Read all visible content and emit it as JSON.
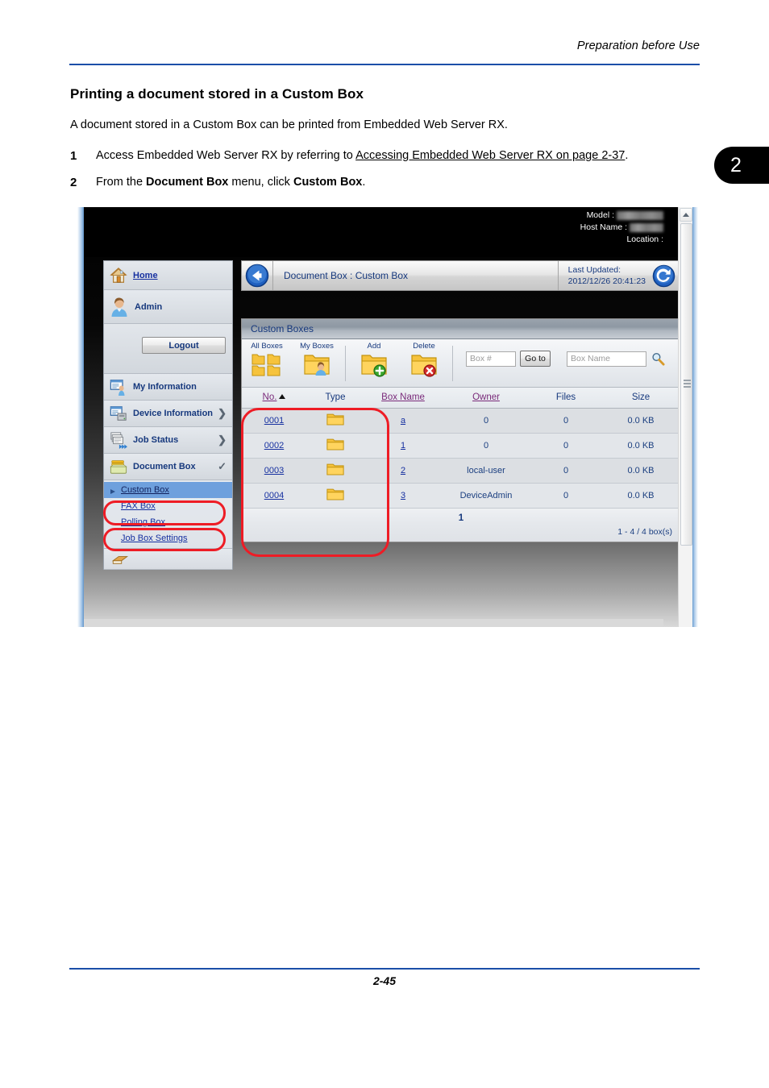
{
  "document": {
    "running_header": "Preparation before Use",
    "chapter_tab": "2",
    "section_title": "Printing a document stored in a Custom Box",
    "intro": "A document stored in a Custom Box can be printed from Embedded Web Server RX.",
    "steps": [
      {
        "num": "1",
        "prefix": "Access Embedded Web Server RX by referring to ",
        "link": "Accessing Embedded Web Server RX on page 2-37",
        "suffix": "."
      },
      {
        "num": "2",
        "prefix": "From the ",
        "bold1": "Document Box",
        "middle": " menu, click ",
        "bold2": "Custom Box",
        "suffix": "."
      }
    ],
    "page_number": "2-45"
  },
  "screenshot": {
    "device_info": {
      "model_label": "Model :",
      "host_label": "Host Name :",
      "location_label": "Location :",
      "model_value": "",
      "host_value": "",
      "location_value": ""
    },
    "sidebar": {
      "home": {
        "label": "Home",
        "icon": "home-icon"
      },
      "user": {
        "label": "Admin",
        "icon": "user-avatar-icon"
      },
      "logout_label": "Logout",
      "items": [
        {
          "label": "My Information",
          "icon": "my-information-icon",
          "chevron": ""
        },
        {
          "label": "Device Information",
          "icon": "device-information-icon",
          "chevron": "❯"
        },
        {
          "label": "Job Status",
          "icon": "job-status-icon",
          "chevron": "❯"
        },
        {
          "label": "Document Box",
          "icon": "document-box-icon",
          "chevron": "✓"
        }
      ],
      "sub_items": [
        {
          "label": "Custom Box",
          "active": true
        },
        {
          "label": "FAX Box",
          "active": false
        },
        {
          "label": "Polling Box",
          "active": false
        },
        {
          "label": "Job Box Settings",
          "active": false
        }
      ]
    },
    "crumbbar": {
      "back_icon": "back-arrow-icon",
      "title": "Document Box : Custom Box",
      "updated_label": "Last Updated:",
      "updated_value": "2012/12/26 20:41:23",
      "refresh_icon": "refresh-icon"
    },
    "panel": {
      "title": "Custom Boxes",
      "tools": [
        {
          "label": "All Boxes",
          "icon": "all-boxes-icon"
        },
        {
          "label": "My Boxes",
          "icon": "my-boxes-icon"
        },
        {
          "label": "Add",
          "icon": "add-box-icon"
        },
        {
          "label": "Delete",
          "icon": "delete-box-icon"
        }
      ],
      "box_number_placeholder": "Box #",
      "goto_label": "Go to",
      "box_name_placeholder": "Box Name",
      "search_icon": "magnifier-icon",
      "columns": [
        "No.",
        "Type",
        "Box Name",
        "Owner",
        "Files",
        "Size"
      ],
      "sort_column": "No.",
      "sort_direction": "asc",
      "rows": [
        {
          "no": "0001",
          "type": "folder-icon",
          "box_name": "a",
          "owner": "0",
          "files": "0",
          "size": "0.0 KB"
        },
        {
          "no": "0002",
          "type": "folder-icon",
          "box_name": "1",
          "owner": "0",
          "files": "0",
          "size": "0.0 KB"
        },
        {
          "no": "0003",
          "type": "folder-icon",
          "box_name": "2",
          "owner": "local-user",
          "files": "0",
          "size": "0.0 KB"
        },
        {
          "no": "0004",
          "type": "folder-icon",
          "box_name": "3",
          "owner": "DeviceAdmin",
          "files": "0",
          "size": "0.0 KB"
        }
      ],
      "current_page": "1",
      "count_text": "1 - 4 / 4 box(s)"
    },
    "annotations": {
      "color": "#ee1c25",
      "highlight_document_box": "Document Box",
      "highlight_custom_box": "Custom Box",
      "highlight_table_region": "No. / Type / Box Name columns"
    }
  }
}
